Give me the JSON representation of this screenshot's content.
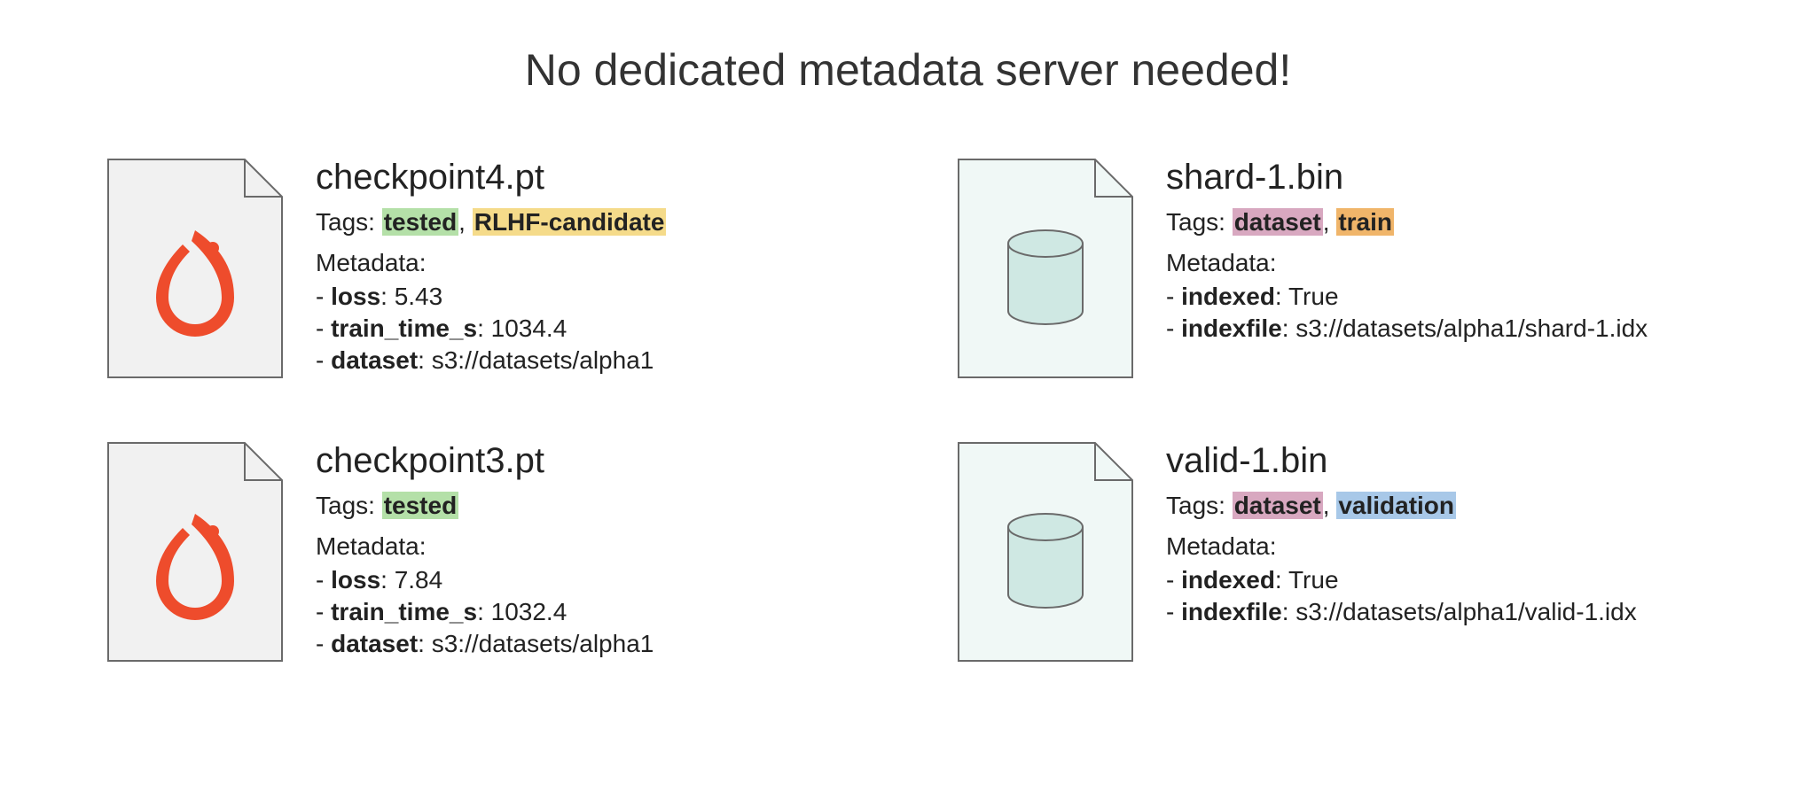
{
  "title": "No dedicated metadata server needed!",
  "tagsLabel": "Tags:",
  "metadataLabel": "Metadata:",
  "tagColors": {
    "tested": "#b4e0a8",
    "RLHF-candidate": "#f5db8a",
    "dataset": "#d8a8c0",
    "train": "#f0b56a",
    "validation": "#a8c8e8"
  },
  "items": [
    {
      "filename": "checkpoint4.pt",
      "iconType": "pytorch",
      "tags": [
        "tested",
        "RLHF-candidate"
      ],
      "metadata": [
        {
          "key": "loss",
          "value": "5.43"
        },
        {
          "key": "train_time_s",
          "value": "1034.4"
        },
        {
          "key": "dataset",
          "value": "s3://datasets/alpha1"
        }
      ]
    },
    {
      "filename": "shard-1.bin",
      "iconType": "db",
      "tags": [
        "dataset",
        "train"
      ],
      "metadata": [
        {
          "key": "indexed",
          "value": "True"
        },
        {
          "key": "indexfile",
          "value": "s3://datasets/alpha1/shard-1.idx"
        }
      ]
    },
    {
      "filename": "checkpoint3.pt",
      "iconType": "pytorch",
      "tags": [
        "tested"
      ],
      "metadata": [
        {
          "key": "loss",
          "value": "7.84"
        },
        {
          "key": "train_time_s",
          "value": "1032.4"
        },
        {
          "key": "dataset",
          "value": "s3://datasets/alpha1"
        }
      ]
    },
    {
      "filename": "valid-1.bin",
      "iconType": "db",
      "tags": [
        "dataset",
        "validation"
      ],
      "metadata": [
        {
          "key": "indexed",
          "value": "True"
        },
        {
          "key": "indexfile",
          "value": "s3://datasets/alpha1/valid-1.idx"
        }
      ]
    }
  ]
}
